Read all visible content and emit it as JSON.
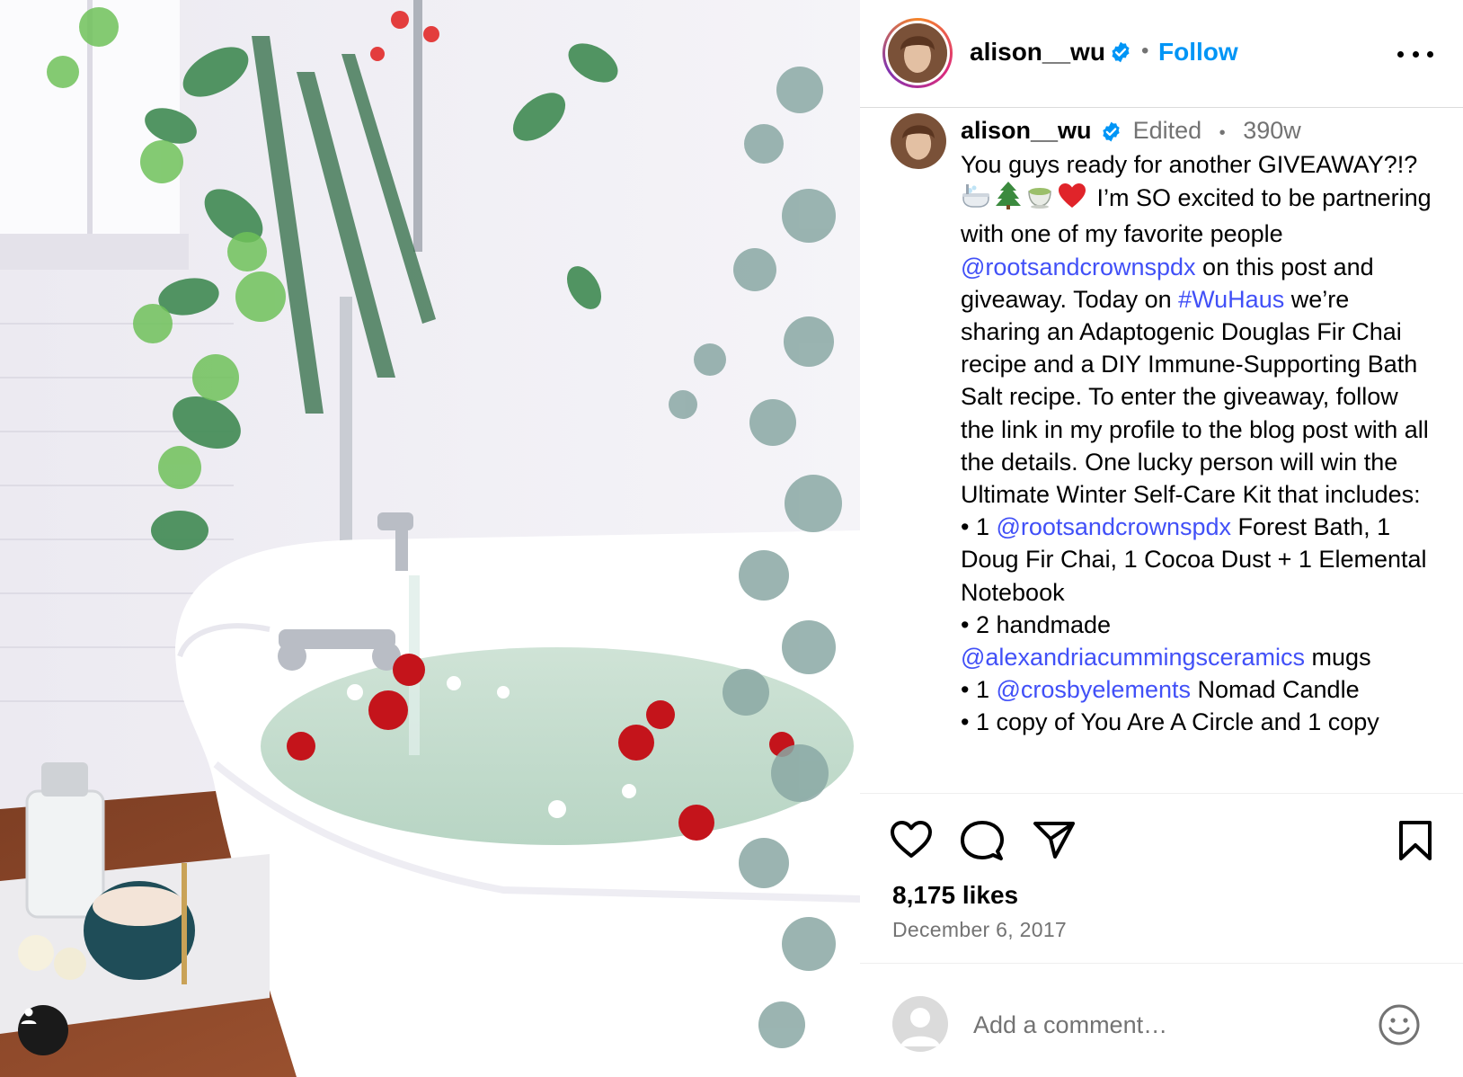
{
  "post": {
    "username": "alison__wu",
    "follow_label": "Follow",
    "separator_dot": "•",
    "edited_label": "Edited",
    "time_ago": "390w",
    "caption": {
      "p1": "You guys ready for another GIVEAWAY?!? ",
      "p2": " I’m SO excited to be partnering with one of my favorite people ",
      "mention1": "@rootsandcrownspdx",
      "p3": " on this post and giveaway. Today on ",
      "hashtag": "#WuHaus",
      "p4": " we’re sharing an Adaptogenic Douglas Fir Chai recipe and a DIY Immune-Supporting Bath Salt recipe. To enter the giveaway, follow the link in my profile to the blog post with all the details. One lucky person will win the Ultimate Winter Self-Care Kit that includes:",
      "b1_pre": "• 1 ",
      "b1_mention": "@rootsandcrownspdx",
      "b1_post": " Forest Bath, 1 Doug Fir Chai, 1 Cocoa Dust + 1 Elemental Notebook",
      "b2_pre": "• 2 handmade ",
      "b2_mention": "@alexandriacummingsceramics",
      "b2_post": " mugs",
      "b3_pre": "• 1 ",
      "b3_mention": "@crosbyelements",
      "b3_post": " Nomad Candle",
      "b4": "• 1 copy of You Are A Circle and 1 copy"
    },
    "caption_emojis": [
      "bathtub",
      "evergreen-tree",
      "teacup",
      "red-heart"
    ],
    "likes": "8,175 likes",
    "date": "December 6, 2017",
    "comment_placeholder": "Add a comment…",
    "icons": [
      "heart-icon",
      "comment-icon",
      "share-icon",
      "bookmark-icon",
      "emoji-icon",
      "more-icon",
      "verified-icon",
      "user-tag-icon"
    ]
  },
  "colors": {
    "link": "#4150f7",
    "follow": "#0095f6",
    "verified": "#0095f6",
    "muted": "#737373"
  }
}
